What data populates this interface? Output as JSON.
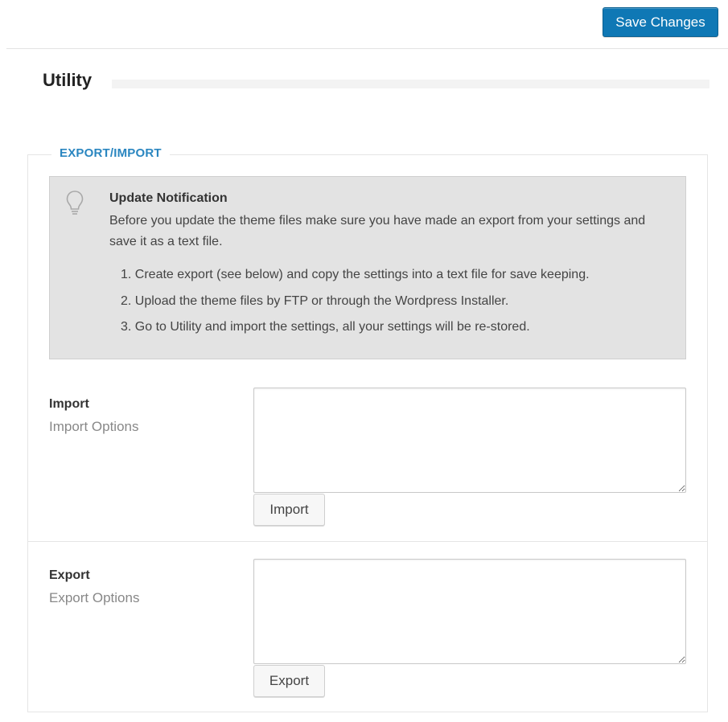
{
  "toolbar": {
    "save_label": "Save Changes"
  },
  "page": {
    "title": "Utility"
  },
  "section": {
    "legend": "EXPORT/IMPORT"
  },
  "notice": {
    "icon": "lightbulb-icon",
    "title": "Update Notification",
    "text": "Before you update the theme files make sure you have made an export from your settings and save it as a text file.",
    "steps": [
      "1. Create export (see below) and copy the settings into a text file for save keeping.",
      "2. Upload the theme files by FTP or through the Wordpress Installer.",
      "3. Go to Utility and import the settings, all your settings will be re-stored."
    ]
  },
  "import": {
    "label": "Import",
    "description": "Import Options",
    "value": "",
    "button": "Import"
  },
  "export": {
    "label": "Export",
    "description": "Export Options",
    "value": "",
    "button": "Export"
  },
  "colors": {
    "accent": "#0f78b5",
    "legend": "#2a86c0",
    "notice_bg": "#e3e3e3"
  }
}
